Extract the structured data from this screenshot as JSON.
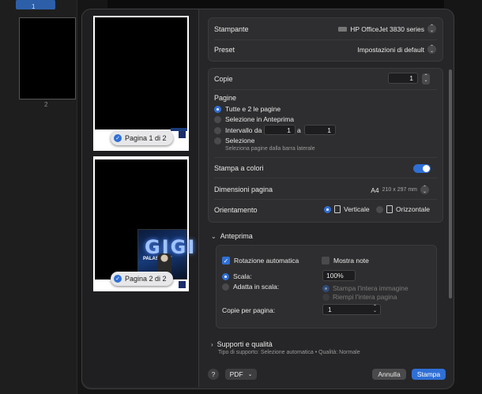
{
  "background_app": {
    "thumb1_number": "1",
    "thumb2_number": "2"
  },
  "preview": {
    "page1_label": "Pagina 1 di 2",
    "page2_label": "Pagina 2 di 2",
    "poster_text": "GIGI",
    "poster_subtext": "PALASPORT"
  },
  "printer": {
    "label": "Stampante",
    "value": "HP OfficeJet 3830 series"
  },
  "preset": {
    "label": "Preset",
    "value": "Impostazioni di default"
  },
  "copies": {
    "label": "Copie",
    "value": "1"
  },
  "pages": {
    "label": "Pagine",
    "options": {
      "all": "Tutte e 2 le pagine",
      "selection_preview": "Selezione in Anteprima",
      "range": "Intervallo da",
      "range_to": "a",
      "range_from_value": "1",
      "range_to_value": "1",
      "selection": "Selezione",
      "selection_hint": "Seleziona pagine dalla barra laterale"
    },
    "selected": "all"
  },
  "color": {
    "label": "Stampa a colori",
    "enabled": true
  },
  "paper_size": {
    "label": "Dimensioni pagina",
    "value": "A4",
    "detail": "210 x 297 mm"
  },
  "orientation": {
    "label": "Orientamento",
    "portrait": "Verticale",
    "landscape": "Orizzontale",
    "selected": "portrait"
  },
  "preview_section": {
    "title": "Anteprima",
    "auto_rotate": "Rotazione automatica",
    "auto_rotate_checked": true,
    "show_notes": "Mostra note",
    "show_notes_checked": false,
    "scale": "Scala:",
    "scale_value": "100%",
    "fit": "Adatta in scala:",
    "fit_print_entire": "Stampa l'intera immagine",
    "fit_fill_entire": "Riempi l'intera pagina",
    "pages_per_sheet_label": "Copie per pagina:",
    "pages_per_sheet_value": "1"
  },
  "media": {
    "title": "Supporti e qualità",
    "summary": "Tipo di supporto: Selezione automatica • Qualità: Normale"
  },
  "footer": {
    "help": "?",
    "pdf": "PDF",
    "cancel": "Annulla",
    "print": "Stampa"
  },
  "colors": {
    "accent": "#2f6fd6",
    "dialog_bg": "#262628",
    "card_bg": "#2e2e30"
  }
}
